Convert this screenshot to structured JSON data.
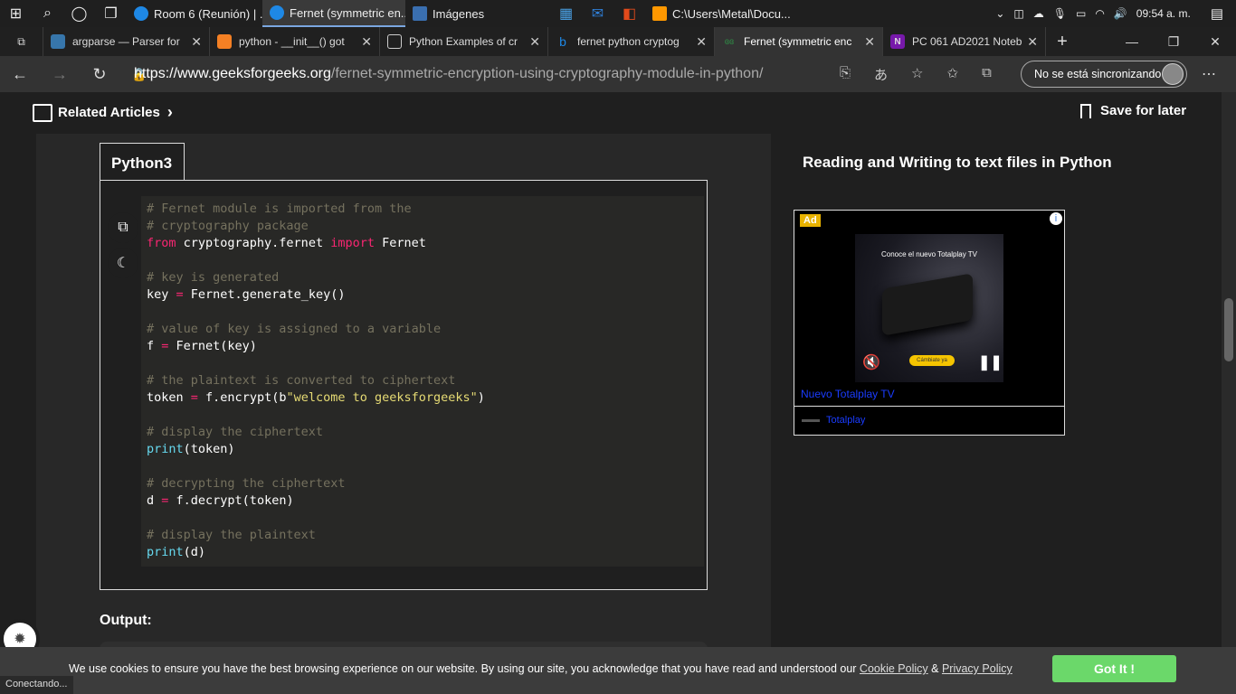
{
  "taskbar": {
    "apps": [
      {
        "label": "Room 6 (Reunión) | ...",
        "color": "#1e88e5"
      },
      {
        "label": "Fernet (symmetric en...",
        "color": "#1e88e5"
      },
      {
        "label": "Imágenes",
        "color": "#3a6fb0"
      },
      {
        "label": "C:\\Users\\Metal\\Docu...",
        "color": "#ff9800"
      }
    ],
    "time": "09:54 a. m."
  },
  "tabs": [
    {
      "label": "argparse — Parser for",
      "icon_color": "#3776ab"
    },
    {
      "label": "python - __init__() got",
      "icon_color": "#f48024"
    },
    {
      "label": "Python Examples of cr",
      "icon_color": "#888888"
    },
    {
      "label": "fernet python cryptog",
      "icon_color": "#1e88e5"
    },
    {
      "label": "Fernet (symmetric enc",
      "icon_color": "#2f8d46"
    },
    {
      "label": "PC 061 AD2021 Noteb",
      "icon_color": "#7719aa"
    }
  ],
  "address": {
    "host": "https://www.geeksforgeeks.org",
    "path": "/fernet-symmetric-encryption-using-cryptography-module-in-python/",
    "sync_label": "No se está sincronizando"
  },
  "page": {
    "related_label": "Related Articles",
    "save_label": "Save for later",
    "code_tab": "Python3",
    "code_lines": [
      [
        {
          "t": "# Fernet module is imported from the",
          "c": "cm"
        }
      ],
      [
        {
          "t": "# cryptography package",
          "c": "cm"
        }
      ],
      [
        {
          "t": "from",
          "c": "kw"
        },
        {
          "t": " cryptography.fernet ",
          "c": ""
        },
        {
          "t": "import",
          "c": "kw"
        },
        {
          "t": " Fernet",
          "c": ""
        }
      ],
      [],
      [
        {
          "t": "# key is generated",
          "c": "cm"
        }
      ],
      [
        {
          "t": "key ",
          "c": ""
        },
        {
          "t": "=",
          "c": "kw"
        },
        {
          "t": " Fernet.generate_key()",
          "c": ""
        }
      ],
      [],
      [
        {
          "t": "# value of key is assigned to a variable",
          "c": "cm"
        }
      ],
      [
        {
          "t": "f ",
          "c": ""
        },
        {
          "t": "=",
          "c": "kw"
        },
        {
          "t": " Fernet(key)",
          "c": ""
        }
      ],
      [],
      [
        {
          "t": "# the plaintext is converted to ciphertext",
          "c": "cm"
        }
      ],
      [
        {
          "t": "token ",
          "c": ""
        },
        {
          "t": "=",
          "c": "kw"
        },
        {
          "t": " f.encrypt(b",
          "c": ""
        },
        {
          "t": "\"welcome to geeksforgeeks\"",
          "c": "st"
        },
        {
          "t": ")",
          "c": ""
        }
      ],
      [],
      [
        {
          "t": "# display the ciphertext",
          "c": "cm"
        }
      ],
      [
        {
          "t": "print",
          "c": "fn"
        },
        {
          "t": "(token)",
          "c": ""
        }
      ],
      [],
      [
        {
          "t": "# decrypting the ciphertext",
          "c": "cm"
        }
      ],
      [
        {
          "t": "d ",
          "c": ""
        },
        {
          "t": "=",
          "c": "kw"
        },
        {
          "t": " f.decrypt(token)",
          "c": ""
        }
      ],
      [],
      [
        {
          "t": "# display the plaintext",
          "c": "cm"
        }
      ],
      [
        {
          "t": "print",
          "c": "fn"
        },
        {
          "t": "(d)",
          "c": ""
        }
      ]
    ],
    "output_label": "Output:",
    "right_title": "Reading and Writing to text files in Python"
  },
  "ad": {
    "badge": "Ad",
    "headline": "Conoce el nuevo  Totalplay TV",
    "cta": "Cámbiate ya",
    "link": "Nuevo Totalplay TV",
    "brand": "Totalplay"
  },
  "cookie": {
    "text": "We use cookies to ensure you have the best browsing experience on our website. By using our site, you acknowledge that you have read and understood our ",
    "policy": "Cookie Policy",
    "amp": " & ",
    "privacy": "Privacy Policy",
    "button": "Got It !"
  },
  "status": "Conectando..."
}
